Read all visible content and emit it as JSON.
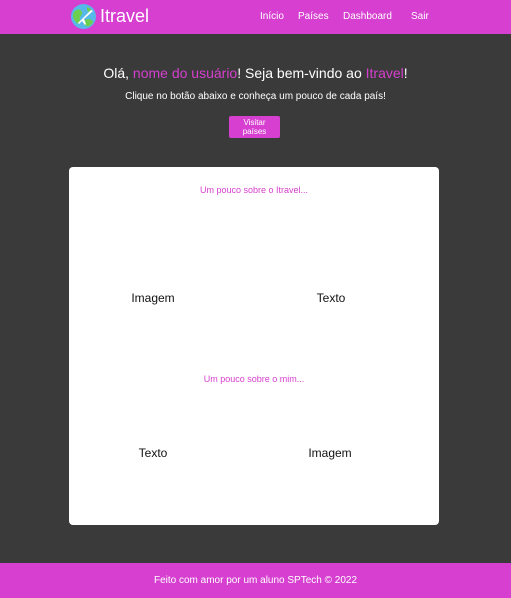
{
  "colors": {
    "brand": "#d63fcf",
    "background": "#3a3a3a",
    "card": "#ffffff"
  },
  "header": {
    "logo_icon": "globe-airplane-icon",
    "logo_text": "Itravel",
    "nav": [
      "Início",
      "Países",
      "Dashboard",
      "Sair"
    ]
  },
  "hero": {
    "greeting_prefix": "Olá, ",
    "username": "nome do usuário",
    "greeting_middle": "! Seja bem-vindo ao ",
    "brand_name": "Itravel",
    "greeting_suffix": "!",
    "subtitle": "Clique no botão abaixo e conheça um pouco de cada país!",
    "button_label": "Visitar países"
  },
  "card": {
    "about_site_title": "Um pouco sobre o Itravel...",
    "about_site_left": "Imagem",
    "about_site_right": "Texto",
    "about_me_title": "Um pouco sobre o mim...",
    "about_me_left": "Texto",
    "about_me_right": "Imagem"
  },
  "footer": {
    "text": "Feito com amor por um aluno SPTech © 2022"
  }
}
